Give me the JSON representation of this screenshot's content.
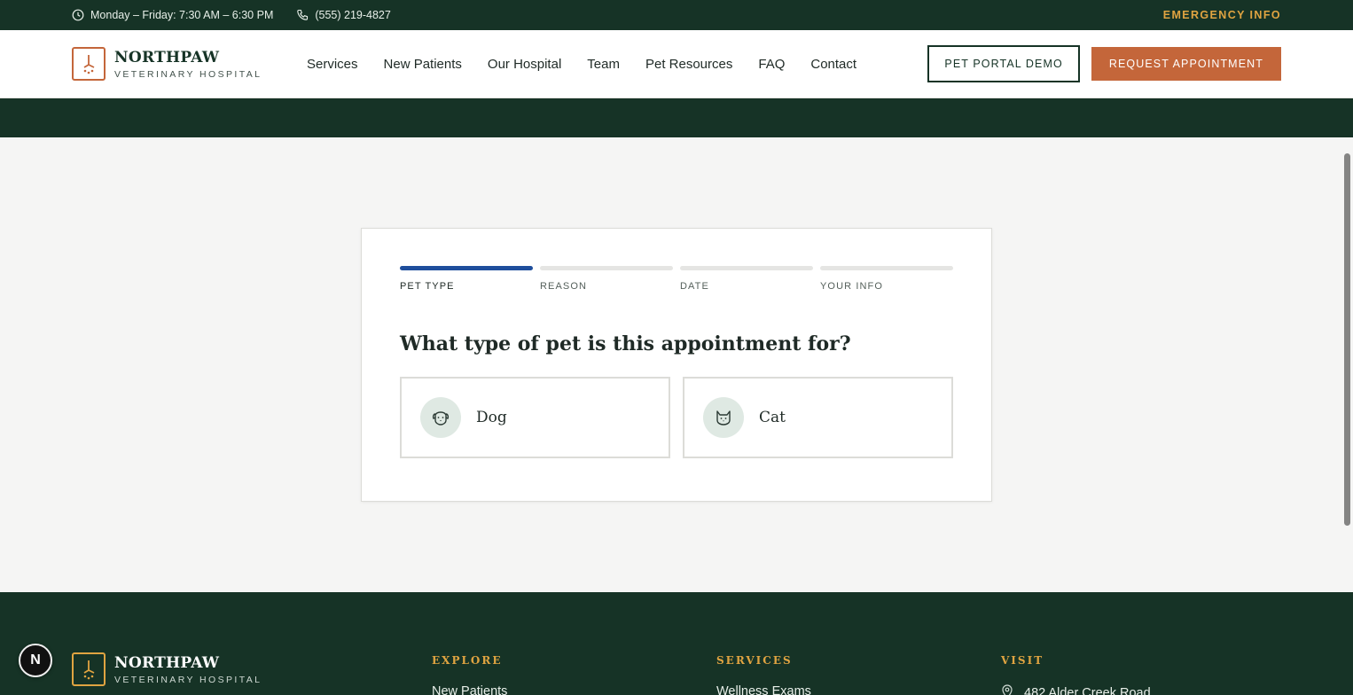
{
  "topbar": {
    "hours": "Monday – Friday: 7:30 AM – 6:30 PM",
    "phone": "(555) 219-4827",
    "emergency": "EMERGENCY INFO"
  },
  "brand": {
    "name": "NORTHPAW",
    "subtitle": "VETERINARY HOSPITAL"
  },
  "nav": {
    "items": [
      "Services",
      "New Patients",
      "Our Hospital",
      "Team",
      "Pet Resources",
      "FAQ",
      "Contact"
    ]
  },
  "header_actions": {
    "portal_label": "PET PORTAL DEMO",
    "request_label": "REQUEST APPOINTMENT"
  },
  "wizard": {
    "steps": [
      "PET TYPE",
      "REASON",
      "DATE",
      "YOUR INFO"
    ],
    "active_step": 1,
    "question": "What type of pet is this appointment for?",
    "options": [
      {
        "label": "Dog",
        "icon": "dog-icon"
      },
      {
        "label": "Cat",
        "icon": "cat-icon"
      }
    ]
  },
  "footer": {
    "explore": {
      "heading": "EXPLORE",
      "first_link": "New Patients"
    },
    "services": {
      "heading": "SERVICES",
      "first_link": "Wellness Exams"
    },
    "visit": {
      "heading": "VISIT",
      "address": "482 Alder Creek Road"
    }
  },
  "badge": {
    "letter": "N"
  },
  "colors": {
    "dark_green": "#163326",
    "accent_orange": "#c4663a",
    "gold": "#e0a441",
    "progress_blue": "#1f4e9c"
  }
}
